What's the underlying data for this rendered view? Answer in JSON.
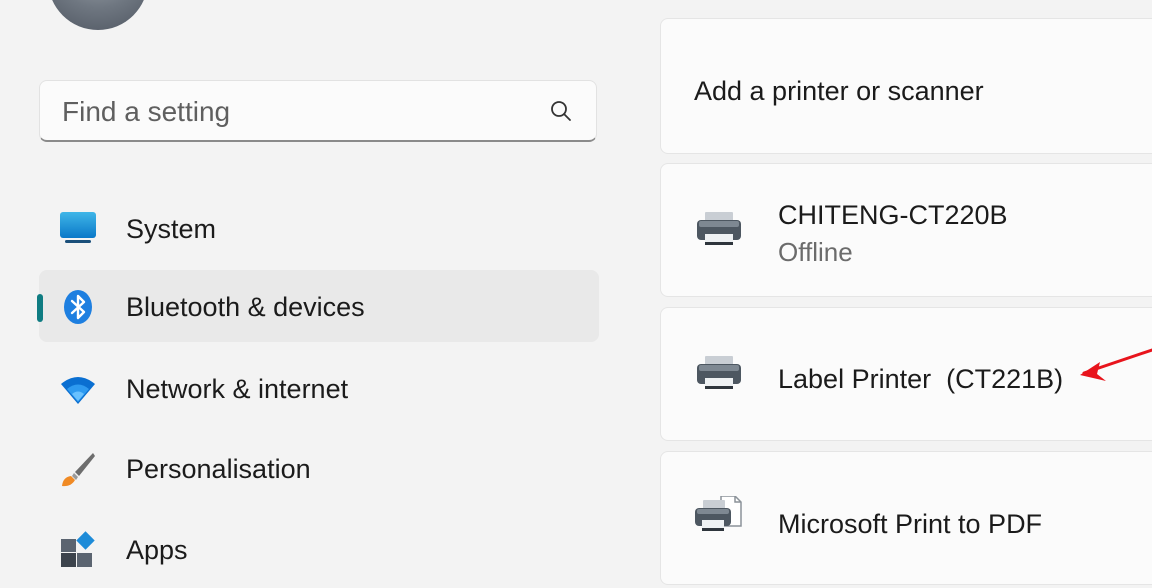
{
  "sidebar": {
    "search": {
      "placeholder": "Find a setting",
      "value": ""
    },
    "items": [
      {
        "label": "System",
        "icon": "system-icon",
        "active": false
      },
      {
        "label": "Bluetooth & devices",
        "icon": "bluetooth-icon",
        "active": true
      },
      {
        "label": "Network & internet",
        "icon": "wifi-icon",
        "active": false
      },
      {
        "label": "Personalisation",
        "icon": "paintbrush-icon",
        "active": false
      },
      {
        "label": "Apps",
        "icon": "apps-icon",
        "active": false
      }
    ]
  },
  "main": {
    "add_printer_label": "Add a printer or scanner",
    "printers": [
      {
        "name": "CHITENG-CT220B",
        "status": "Offline",
        "icon": "printer-icon"
      },
      {
        "name": "Label Printer  (CT221B)",
        "status": "",
        "icon": "printer-icon"
      },
      {
        "name": "Microsoft Print to PDF",
        "status": "",
        "icon": "pdf-printer-icon"
      }
    ]
  },
  "colors": {
    "accent": "#0f7c82",
    "annotation": "#e8141c",
    "background": "#f3f3f3",
    "card": "#fbfbfb"
  }
}
